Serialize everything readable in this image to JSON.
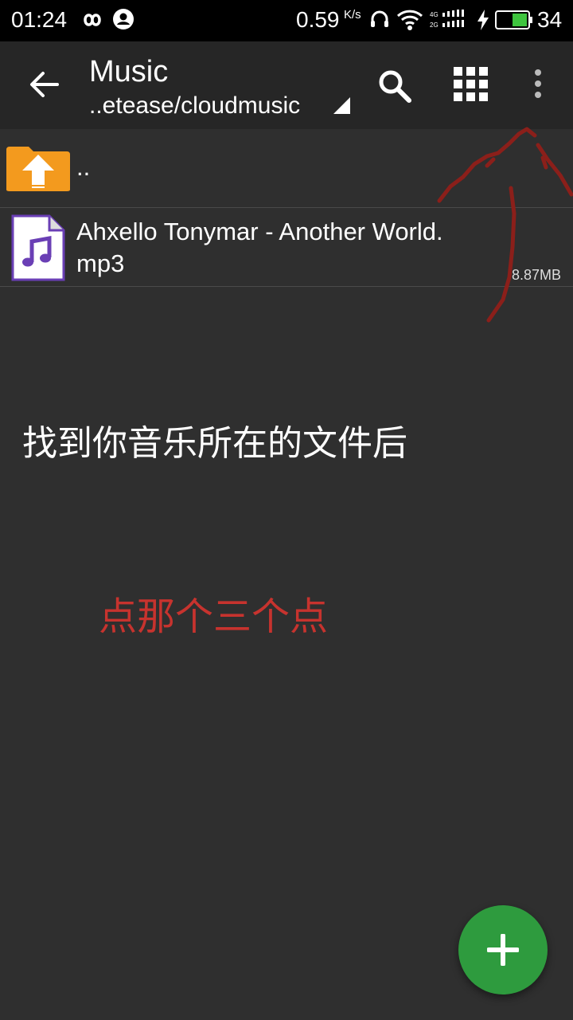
{
  "status_bar": {
    "time": "01:24",
    "speed_value": "0.59",
    "speed_unit": "K/s",
    "battery": "34",
    "icons": [
      "infinity-icon",
      "account-icon",
      "headset-icon",
      "wifi-icon",
      "signal-icon",
      "charging-icon",
      "battery-icon"
    ]
  },
  "toolbar": {
    "title": "Music",
    "path": "..etease/cloudmusic",
    "icons": [
      "back-arrow-icon",
      "dropdown-triangle-icon",
      "search-icon",
      "grid-view-icon",
      "more-vert-icon"
    ]
  },
  "files": [
    {
      "name": "..",
      "icon": "folder-up-icon",
      "size": ""
    },
    {
      "name_line1": "Ahxello Tonymar - Another World.",
      "name_line2": "mp3",
      "icon": "audio-file-icon",
      "size": "8.87MB"
    }
  ],
  "annotations": {
    "instruction_white": "找到你音乐所在的文件后",
    "instruction_red": "点那个三个点",
    "ink_color": "#8b1f1a"
  },
  "fab": {
    "icon": "plus-icon",
    "color": "#2e9b3e"
  },
  "colors": {
    "background": "#2f2f2f",
    "toolbar": "#262626",
    "folder": "#f39a1e",
    "audio": "#6a3fb5"
  }
}
